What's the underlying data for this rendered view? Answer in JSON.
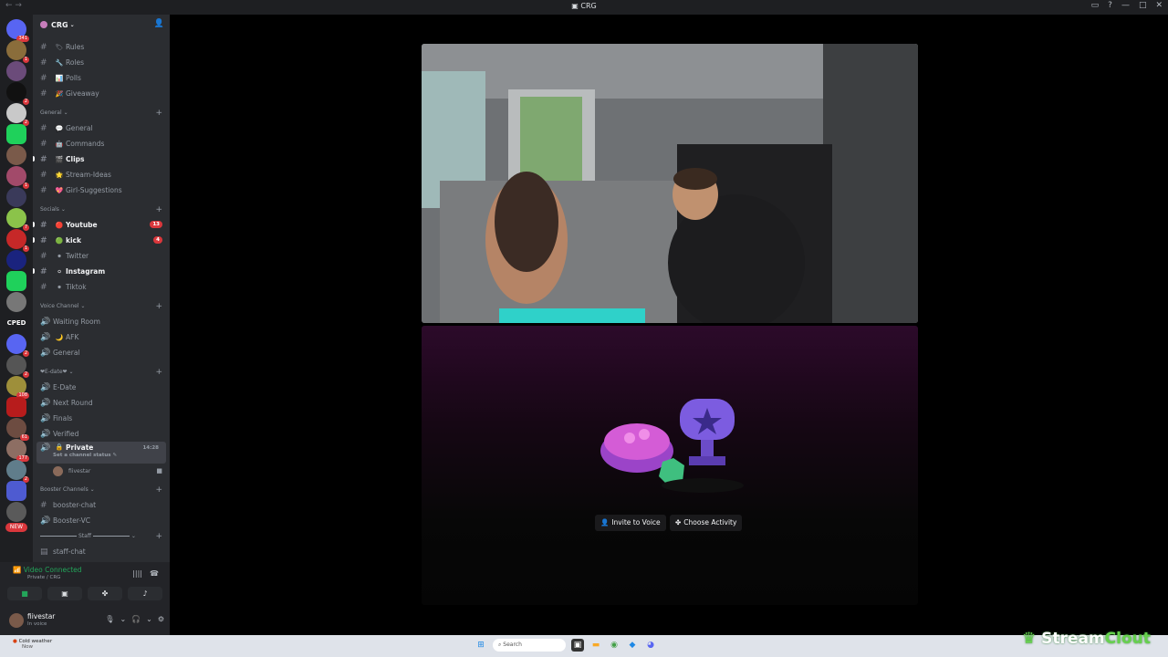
{
  "window": {
    "title": "CRG"
  },
  "servers": [
    {
      "badge": "341"
    },
    {
      "badge": "1"
    },
    {
      "badge": ""
    },
    {
      "badge": "2"
    },
    {
      "badge": "2"
    },
    {
      "badge": ""
    },
    {
      "badge": ""
    },
    {
      "badge": "1"
    },
    {
      "badge": ""
    },
    {
      "badge": "7"
    },
    {
      "badge": "1"
    },
    {
      "badge": ""
    },
    {
      "badge": ""
    },
    {
      "badge": "2"
    },
    {
      "badge": "2"
    },
    {
      "badge": "108"
    },
    {
      "badge": ""
    },
    {
      "badge": "61"
    },
    {
      "badge": "177"
    },
    {
      "badge": "2"
    },
    {
      "badge": ""
    },
    {
      "badge": ""
    }
  ],
  "server_text": {
    "cped": "CPED",
    "new": "NEW"
  },
  "guild": {
    "name": "CRG"
  },
  "channels_top": [
    {
      "emoji": "🏷",
      "name": "Rules"
    },
    {
      "emoji": "🔧",
      "name": "Roles"
    },
    {
      "emoji": "📊",
      "name": "Polls"
    },
    {
      "emoji": "🎉",
      "name": "Giveaway"
    }
  ],
  "cat_general": "General",
  "channels_general": [
    {
      "emoji": "💬",
      "name": "General",
      "bright": false
    },
    {
      "emoji": "🤖",
      "name": "Commands",
      "bright": false
    },
    {
      "emoji": "🎬",
      "name": "Clips",
      "bright": true
    },
    {
      "emoji": "🌟",
      "name": "Stream-Ideas",
      "bright": false
    },
    {
      "emoji": "💖",
      "name": "Girl-Suggestions",
      "bright": false
    }
  ],
  "cat_socials": "Socials",
  "channels_socials": [
    {
      "emoji": "🔴",
      "name": "Youtube",
      "bright": true,
      "badge": "13"
    },
    {
      "emoji": "🟢",
      "name": "kick",
      "bright": true,
      "badge": "4"
    },
    {
      "emoji": "⚫",
      "name": "Twitter",
      "bright": false,
      "badge": ""
    },
    {
      "emoji": "⚪",
      "name": "Instagram",
      "bright": true,
      "badge": ""
    },
    {
      "emoji": "⚫",
      "name": "Tiktok",
      "bright": false,
      "badge": ""
    }
  ],
  "cat_voice": "Voice Channel",
  "voice_channels": [
    {
      "name": "Waiting Room"
    },
    {
      "name": "AFK"
    },
    {
      "name": "General"
    }
  ],
  "cat_edate": "E-date",
  "edate_channels": [
    {
      "name": "E-Date"
    },
    {
      "name": "Next Round"
    },
    {
      "name": "Finals"
    },
    {
      "name": "Verified"
    }
  ],
  "private_channel": {
    "name": "Private",
    "time": "14:28",
    "status": "Set a channel status"
  },
  "voice_user": {
    "name": "fiivestar"
  },
  "cat_booster": "Booster Channels",
  "booster_channels": [
    {
      "name": "booster-chat"
    },
    {
      "name": "Booster-VC"
    }
  ],
  "cat_staff": "Staff",
  "staff_channel": {
    "name": "staff-chat"
  },
  "voice_panel": {
    "status": "Video Connected",
    "location": "Private / CRG"
  },
  "me": {
    "name": "fiivestar",
    "status": "In voice"
  },
  "activity": {
    "invite": "Invite to Voice",
    "choose": "Choose Activity"
  },
  "taskbar": {
    "weather_title": "Cold weather",
    "weather_sub": "Now",
    "search": "Search"
  },
  "watermark": {
    "a": "Stream",
    "b": "Clout"
  }
}
